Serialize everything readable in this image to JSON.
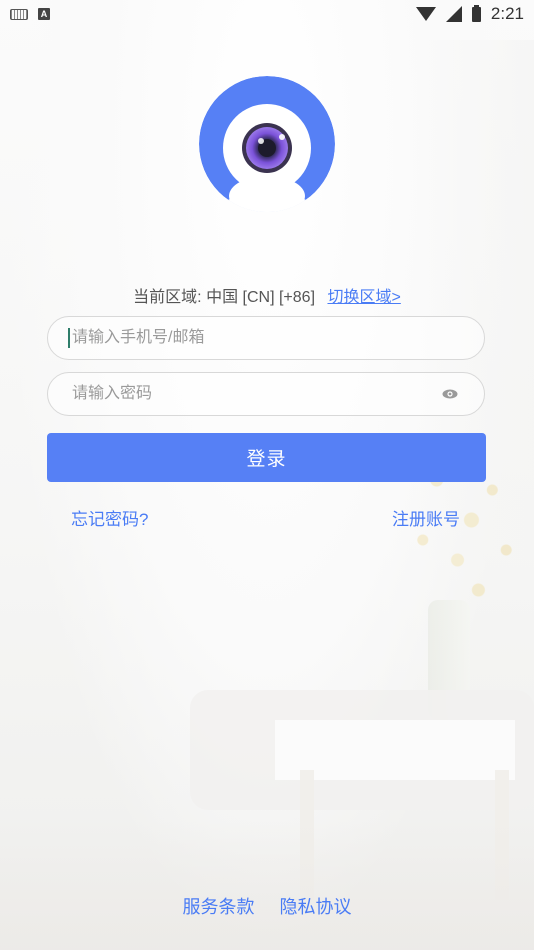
{
  "status_bar": {
    "time": "2:21",
    "keyboard_icon": "keyboard-icon",
    "a_badge": "A",
    "wifi_icon": "wifi-icon",
    "signal_icon": "signal-icon",
    "battery_icon": "battery-charging-icon"
  },
  "logo": {
    "icon": "camera-eye-logo",
    "primary_color": "#5680f5",
    "lens_color": "#7a4fd8"
  },
  "region": {
    "label": "当前区域:",
    "country": "中国 [CN]",
    "code": "[+86]",
    "switch_label": "切换区域>"
  },
  "form": {
    "phone_placeholder": "请输入手机号/邮箱",
    "phone_value": "",
    "password_placeholder": "请输入密码",
    "password_value": "",
    "eye_icon": "eye-icon"
  },
  "actions": {
    "login_label": "登录",
    "forgot_label": "忘记密码?",
    "register_label": "注册账号"
  },
  "footer": {
    "terms_label": "服务条款",
    "privacy_label": "隐私协议"
  },
  "colors": {
    "accent": "#5680f5",
    "link": "#4a7cf5"
  }
}
